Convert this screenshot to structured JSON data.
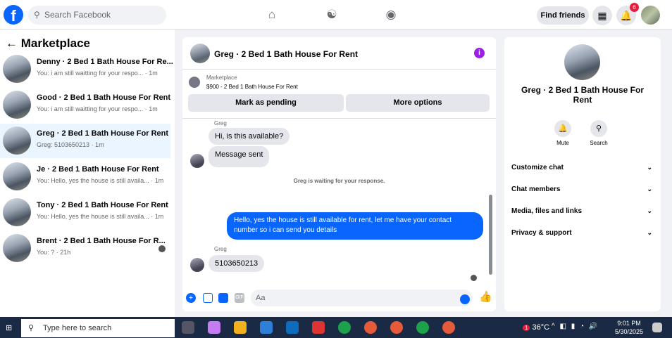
{
  "header": {
    "search_placeholder": "Search Facebook",
    "find_friends": "Find friends",
    "notif_count": "6"
  },
  "left": {
    "title": "Marketplace",
    "conversations": [
      {
        "title": "Denny · 2 Bed 1 Bath House For Re...",
        "sub": "You: i am still waitting for your respo... · 1m"
      },
      {
        "title": "Good · 2 Bed 1 Bath House For Rent",
        "sub": "You: i am still waitting for your respo... · 1m"
      },
      {
        "title": "Greg · 2 Bed 1 Bath House For Rent",
        "sub": "Greg: 5103650213 · 1m"
      },
      {
        "title": "Je · 2 Bed 1 Bath House For Rent",
        "sub": "You: Hello, yes the house is still availa... · 1m"
      },
      {
        "title": "Tony · 2 Bed 1 Bath House For Rent",
        "sub": "You: Hello, yes the house is still availa... · 1m"
      },
      {
        "title": "Brent · 2 Bed 1 Bath House For R...",
        "sub": "You: ? · 21h"
      }
    ]
  },
  "chat": {
    "title": "Greg · 2 Bed 1 Bath House For Rent",
    "marketplace_label": "Marketplace",
    "price_line": "$900 - 2 Bed 1 Bath House For Rent",
    "mark_pending": "Mark as pending",
    "more_options": "More options",
    "sender1": "Greg",
    "msg1": "Hi, is this available?",
    "msg2": "Message sent",
    "waiting": "Greg is waiting for your response.",
    "outgoing": "Hello, yes the house is still available for rent, let me have your contact number so i can send you  details",
    "sender2": "Greg",
    "msg3": "5103650213",
    "composer_placeholder": "Aa"
  },
  "details": {
    "title": "Greg · 2 Bed 1 Bath House For Rent",
    "mute": "Mute",
    "search": "Search",
    "rows": [
      "Customize chat",
      "Chat members",
      "Media, files and links",
      "Privacy & support"
    ]
  },
  "taskbar": {
    "search": "Type here to search",
    "temp": "36°C",
    "weather_badge": "1",
    "time": "9:01 PM",
    "date": "5/30/2025"
  }
}
